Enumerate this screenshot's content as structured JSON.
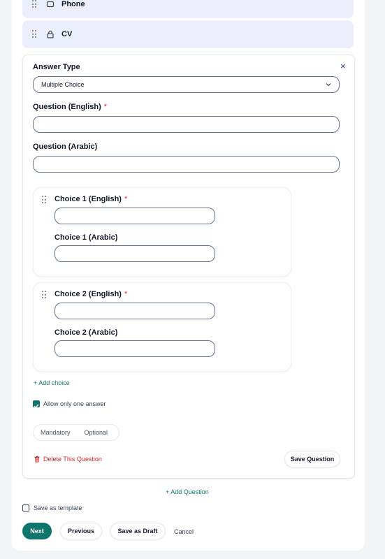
{
  "fields": [
    {
      "label": "Phone",
      "icon": "square-icon"
    },
    {
      "label": "CV",
      "icon": "lock-icon"
    }
  ],
  "question": {
    "answer_type_label": "Answer Type",
    "answer_type_value": "Multiple Choice",
    "question_en_label": "Question (English)",
    "question_ar_label": "Question (Arabic)",
    "required_mark": "*",
    "choices": [
      {
        "en_label": "Choice 1 (English)",
        "ar_label": "Choice 1 (Arabic)"
      },
      {
        "en_label": "Choice 2 (English)",
        "ar_label": "Choice 2 (Arabic)"
      }
    ],
    "add_choice": "+ Add choice",
    "allow_one": "Allow only one answer",
    "allow_one_checked": true,
    "mandatory": "Mandatory",
    "optional": "Optional",
    "delete": "Delete This Question",
    "save_question": "Save Question",
    "close_glyph": "×"
  },
  "add_question": "+ Add Question",
  "save_template": "Save as template",
  "footer": {
    "next": "Next",
    "previous": "Previous",
    "save_draft": "Save as Draft",
    "cancel": "Cancel"
  },
  "colors": {
    "accent": "#0f766e",
    "danger": "#dc2626"
  }
}
